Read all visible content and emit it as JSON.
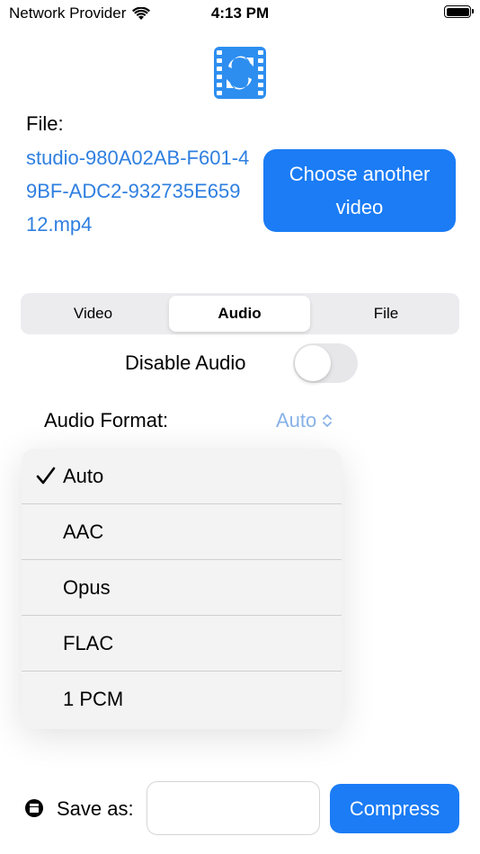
{
  "status_bar": {
    "carrier": "Network Provider",
    "time": "4:13 PM",
    "wifi_icon": "wifi-icon",
    "battery_icon": "battery-full-icon"
  },
  "app": {
    "logo_icon": "video-convert-icon",
    "accent_color": "#1b7cf5"
  },
  "file": {
    "label": "File:",
    "name": "studio-980A02AB-F601-49BF-ADC2-932735E65912.mp4",
    "choose_button": "Choose another video"
  },
  "tabs": [
    {
      "label": "Video",
      "selected": false
    },
    {
      "label": "Audio",
      "selected": true
    },
    {
      "label": "File",
      "selected": false
    }
  ],
  "audio": {
    "disable_label": "Disable Audio",
    "disable_on": false,
    "format_label": "Audio Format:",
    "format_value": "Auto",
    "format_options": [
      {
        "label": "Auto",
        "checked": true
      },
      {
        "label": "AAC",
        "checked": false
      },
      {
        "label": "Opus",
        "checked": false
      },
      {
        "label": "FLAC",
        "checked": false
      },
      {
        "label": "1 PCM",
        "checked": false
      }
    ]
  },
  "bottom": {
    "save_icon": "save-icon",
    "save_label": "Save as:",
    "save_value": "",
    "compress_button": "Compress"
  }
}
